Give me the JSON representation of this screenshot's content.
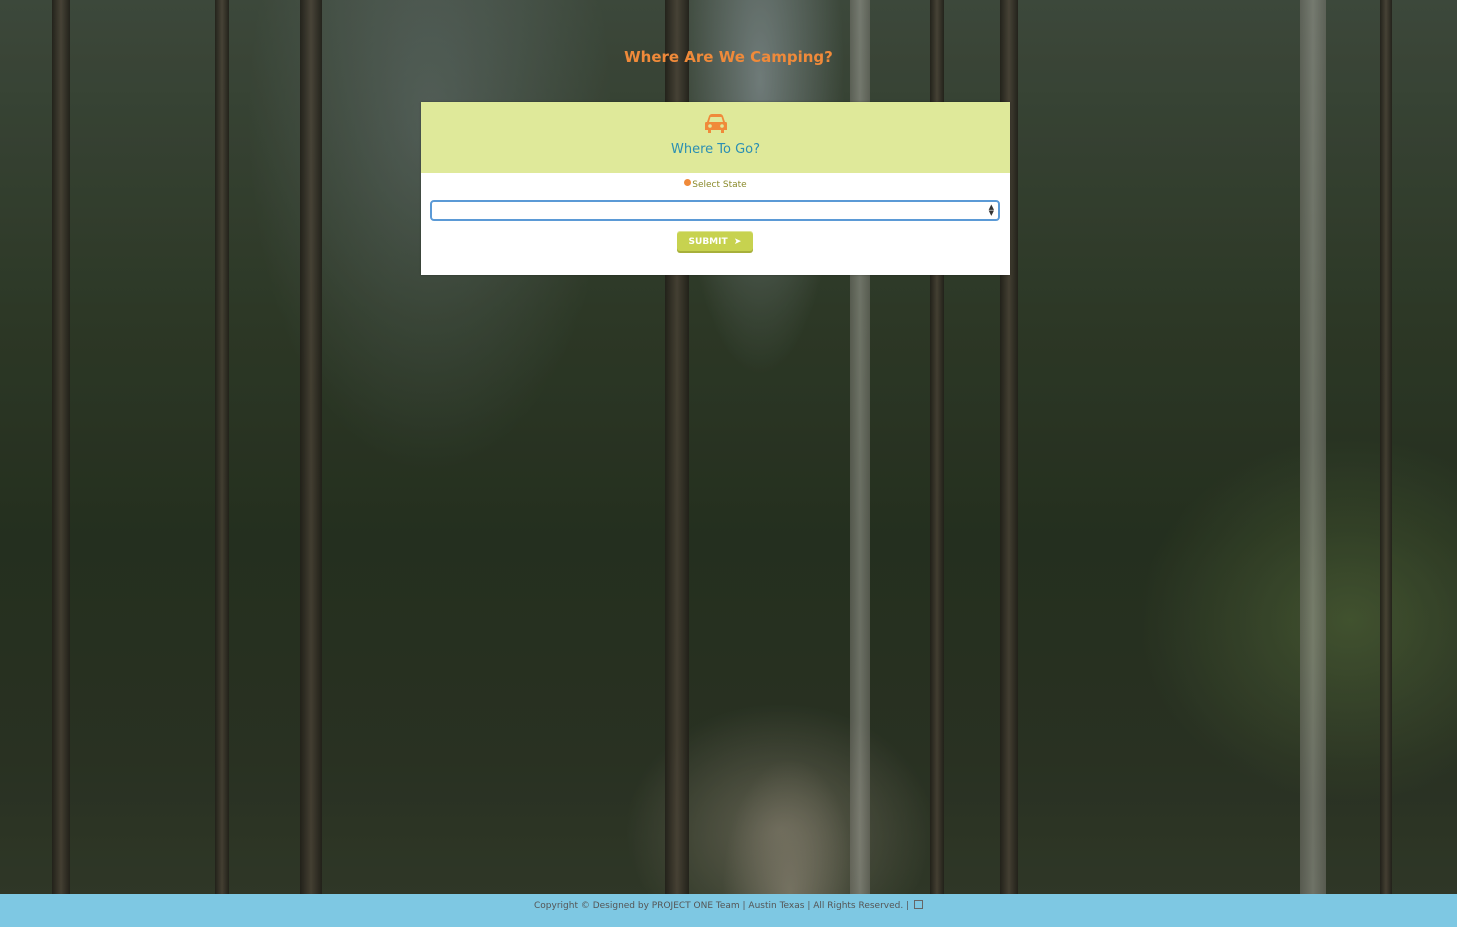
{
  "header": {
    "title": "Where Are We Camping?"
  },
  "card": {
    "icon": "car-icon",
    "title": "Where To Go?",
    "field_label": "Select State",
    "required_icon": "alert-dot-icon",
    "select_value": "",
    "submit_label": "SUBMIT",
    "submit_icon": "arrow-right-icon"
  },
  "footer": {
    "text": "Copyright © Designed by PROJECT ONE Team | Austin Texas | All Rights Reserved. |",
    "icon": "github-icon"
  },
  "colors": {
    "title": "#f08a3a",
    "card_header": "#dfe99a",
    "card_title": "#2b8fb3",
    "button": "#c7d24f",
    "footer": "#7ec8e3"
  }
}
